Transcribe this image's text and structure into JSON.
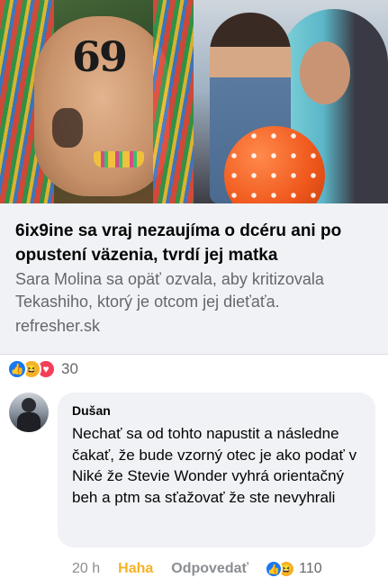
{
  "post": {
    "link_preview": {
      "title": "6ix9ine sa vraj nezaujíma o dcéru ani po opustení väzenia, tvrdí jej matka",
      "description": "Sara Molina sa opäť ozvala, aby kritizovala Tekashiho, ktorý je otcom jej dieťaťa.",
      "domain": "refresher.sk",
      "image_left_tattoo_text": "69"
    },
    "reactions": {
      "icons": [
        "like-icon",
        "haha-icon",
        "love-icon"
      ],
      "count": "30"
    }
  },
  "comment": {
    "author": "Dušan",
    "text": "Nechať sa od tohto napustit a následne čakať, že bude vzorný otec je ako podať v Niké že Stevie Wonder vyhrá orientačný beh a ptm sa sťažovať že ste nevyhrali",
    "time": "20 h",
    "haha_label": "Haha",
    "reply_label": "Odpovedať",
    "reaction_icons": [
      "like-icon",
      "haha-icon"
    ],
    "reaction_count": "110"
  },
  "colors": {
    "like": "#1877f2",
    "haha": "#f7b125",
    "love": "#f33e58",
    "card_bg": "#f0f2f5",
    "secondary_text": "#65676b"
  }
}
